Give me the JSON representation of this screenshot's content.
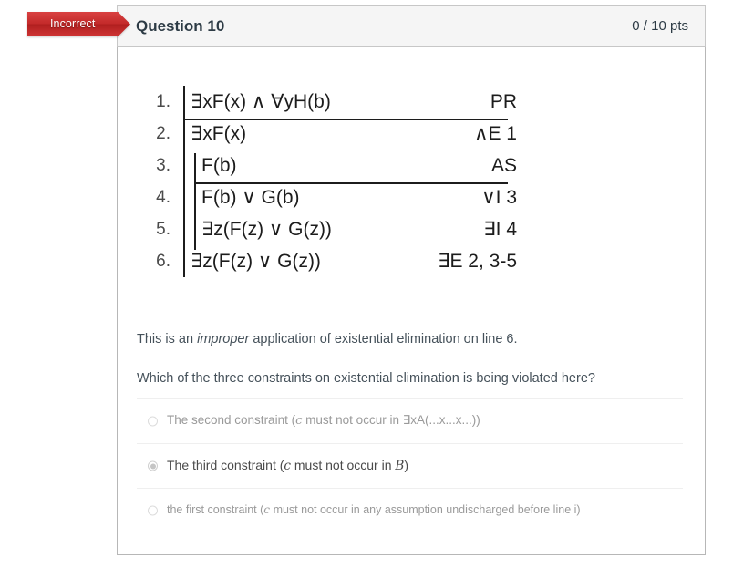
{
  "banner": {
    "label": "Incorrect",
    "color": "#c32a2a"
  },
  "header": {
    "title": "Question 10",
    "points": "0 / 10 pts"
  },
  "proof": {
    "rows": [
      {
        "num": "1.",
        "formula": "∃xF(x) ∧ ∀yH(b)",
        "justification": "PR",
        "level": 1
      },
      {
        "num": "2.",
        "formula": "∃xF(x)",
        "justification": "∧E 1",
        "level": 1
      },
      {
        "num": "3.",
        "formula": "F(b)",
        "justification": "AS",
        "level": 2
      },
      {
        "num": "4.",
        "formula": "F(b) ∨ G(b)",
        "justification": "∨I 3",
        "level": 2
      },
      {
        "num": "5.",
        "formula": "∃z(F(z) ∨ G(z))",
        "justification": "∃I 4",
        "level": 2
      },
      {
        "num": "6.",
        "formula": "∃z(F(z) ∨ G(z))",
        "justification": "∃E 2, 3-5",
        "level": 1
      }
    ]
  },
  "prompt": {
    "line1_before": "This is an ",
    "line1_em": "improper",
    "line1_after": " application of existential elimination on line 6.",
    "line2": "Which of the three constraints on existential elimination is being violated here?"
  },
  "answers": [
    {
      "before": "The second constraint (",
      "symbol": "c",
      "after": " must not occur in ∃xA(...x...x...))",
      "selected": false,
      "small": false
    },
    {
      "before": "The third constraint (",
      "symbol": "c",
      "after": " must not occur in ",
      "symbol2": "B",
      "tail": ")",
      "selected": true,
      "small": false
    },
    {
      "before": "the first constraint (",
      "symbol": "c",
      "after": " must not occur in any assumption undischarged before line i)",
      "selected": false,
      "small": true
    }
  ]
}
